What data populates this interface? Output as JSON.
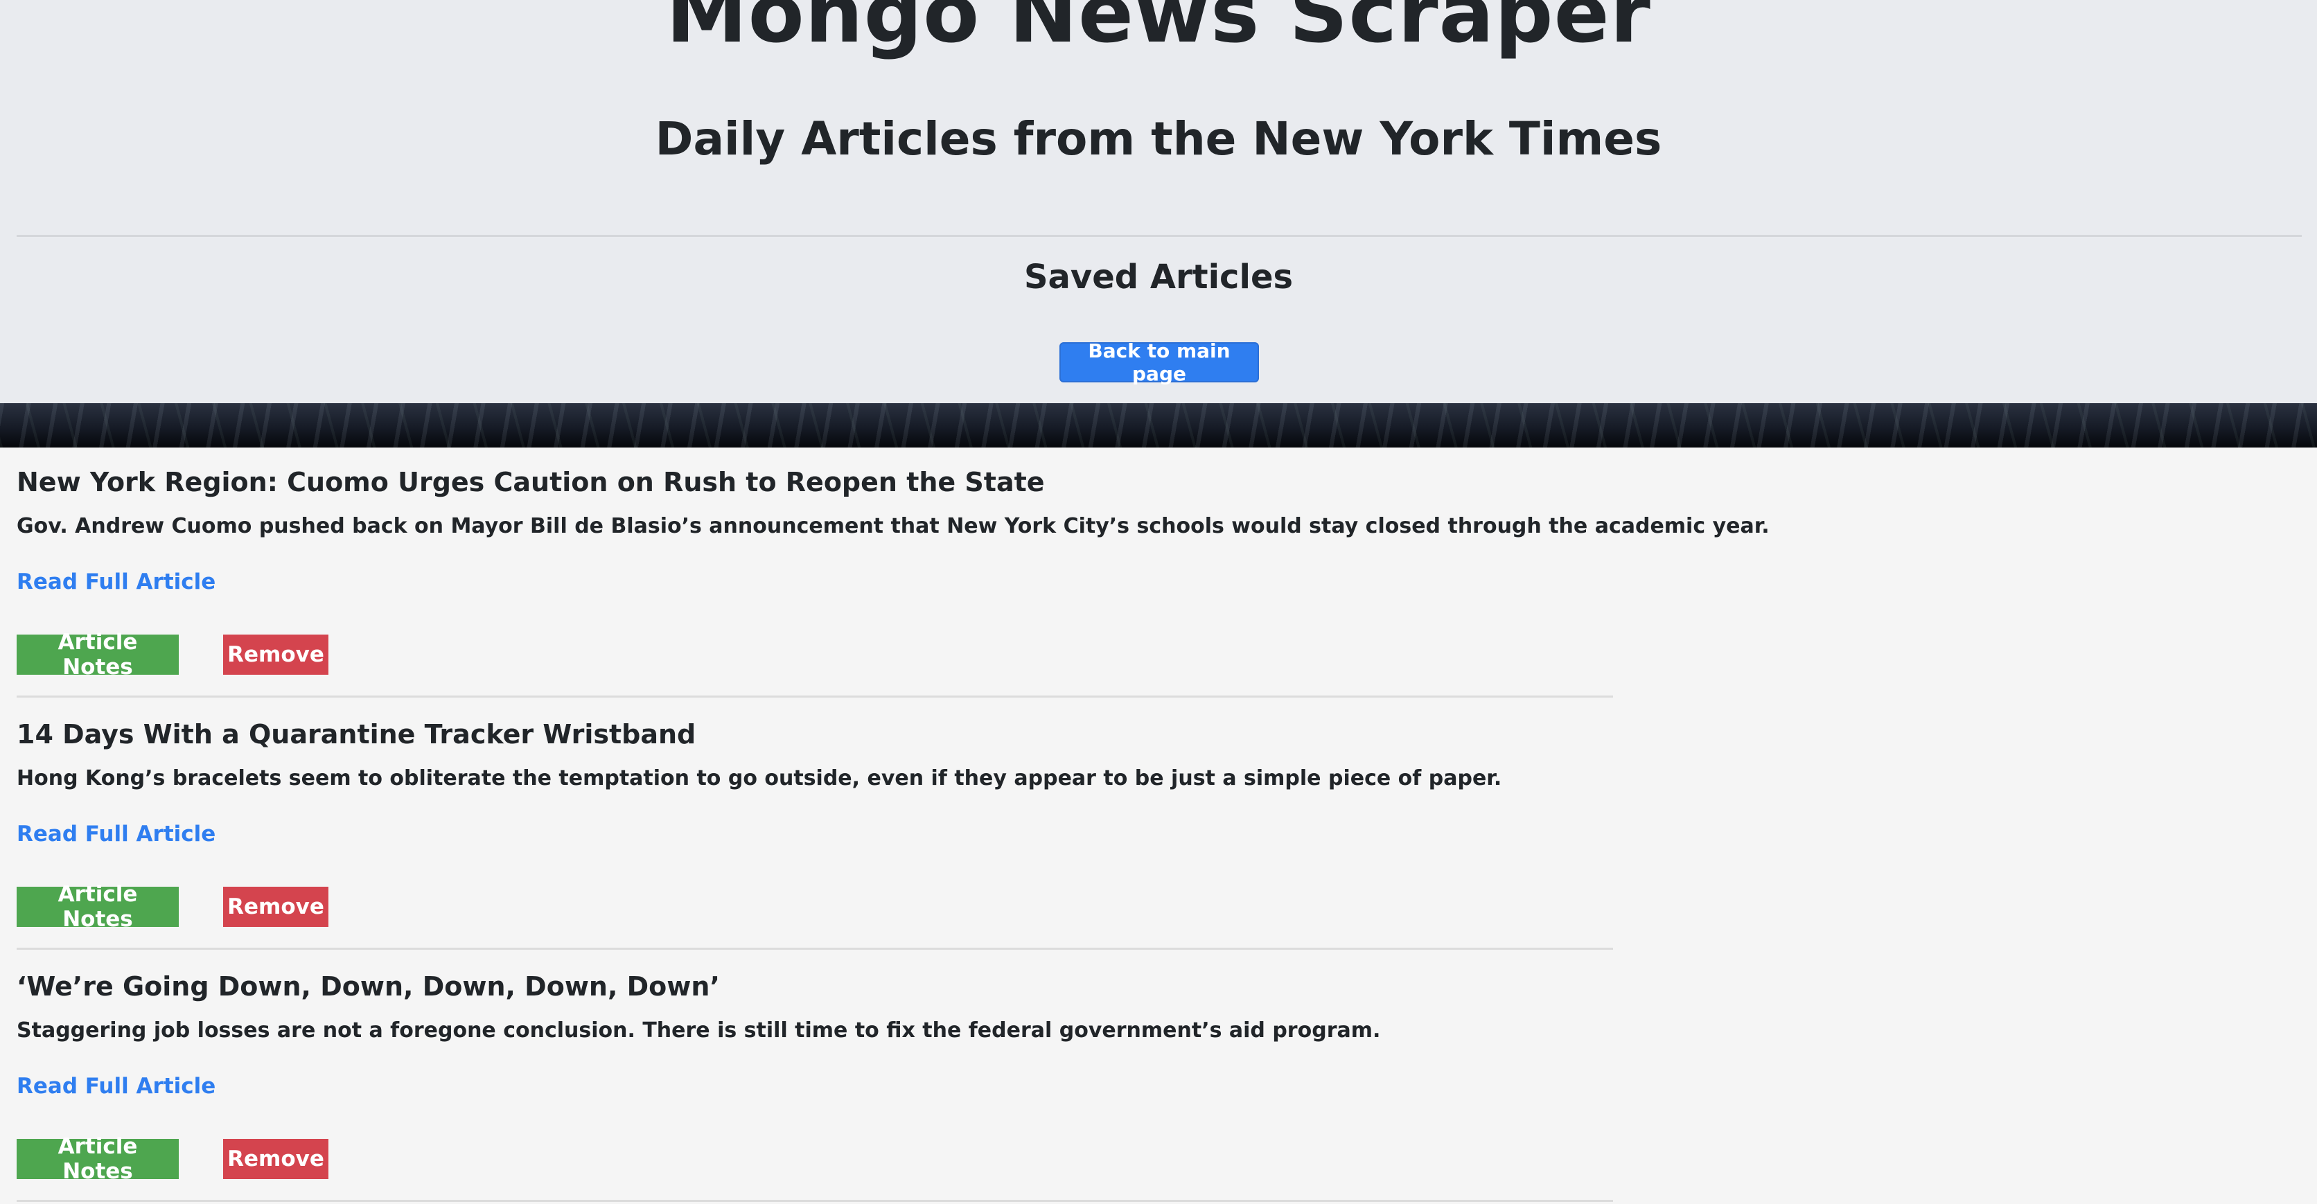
{
  "header": {
    "title": "Mongo News Scraper",
    "subtitle": "Daily Articles from the New York Times",
    "section_title": "Saved Articles",
    "back_button_label": "Back to main page"
  },
  "articles": [
    {
      "title": "New York Region: Cuomo Urges Caution on Rush to Reopen the State",
      "summary": "Gov. Andrew Cuomo pushed back on Mayor Bill de Blasio’s announcement that New York City’s schools would stay closed through the academic year.",
      "link_label": "Read Full Article",
      "notes_label": "Article Notes",
      "remove_label": "Remove"
    },
    {
      "title": "14 Days With a Quarantine Tracker Wristband",
      "summary": "Hong Kong’s bracelets seem to obliterate the temptation to go outside, even if they appear to be just a simple piece of paper.",
      "link_label": "Read Full Article",
      "notes_label": "Article Notes",
      "remove_label": "Remove"
    },
    {
      "title": "‘We’re Going Down, Down, Down, Down, Down’",
      "summary": "Staggering job losses are not a foregone conclusion. There is still time to fix the federal government’s aid program.",
      "link_label": "Read Full Article",
      "notes_label": "Article Notes",
      "remove_label": "Remove"
    }
  ],
  "colors": {
    "primary": "#2f7ef0",
    "success": "#4ea64f",
    "danger": "#d4444e",
    "jumbotron_bg": "#e9ebef",
    "page_bg": "#f5f5f5",
    "text": "#212529"
  }
}
